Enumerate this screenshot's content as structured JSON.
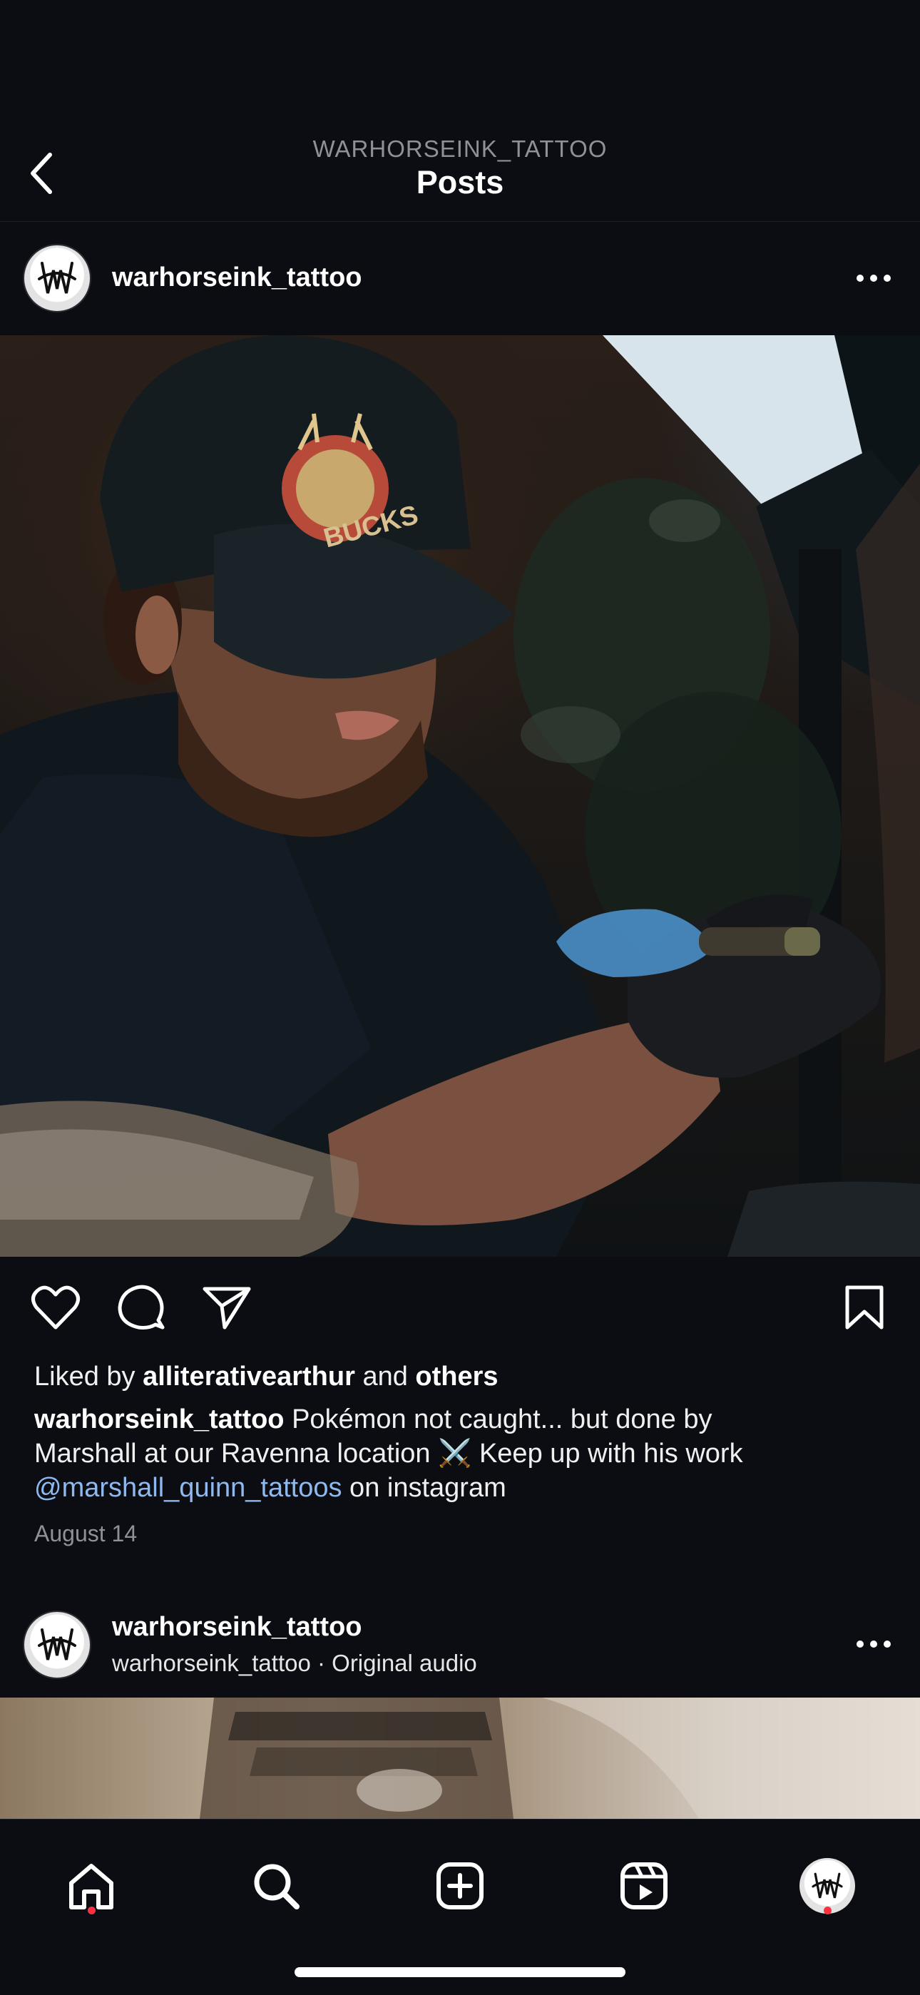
{
  "header": {
    "subtitle": "WARHORSEINK_TATTOO",
    "title": "Posts"
  },
  "post1": {
    "username": "warhorseink_tattoo",
    "liked_by_prefix": "Liked by ",
    "liked_by_user": "alliterativearthur",
    "liked_by_and": " and ",
    "liked_by_others": "others",
    "caption_username": "warhorseink_tattoo",
    "caption_line1": " Pokémon not caught... but done by",
    "caption_line2": "Marshall at our Ravenna location ⚔️ Keep up with his work",
    "caption_mention": "@marshall_quinn_tattoos",
    "caption_line3_rest": " on instagram",
    "date": "August 14",
    "photo_text": "BUCKS"
  },
  "post2": {
    "username": "warhorseink_tattoo",
    "audio": "warhorseink_tattoo · Original audio"
  },
  "icons": {
    "back": "chevron-left-icon",
    "more": "more-horizontal-icon",
    "like": "heart-icon",
    "comment": "comment-icon",
    "share": "send-icon",
    "save": "bookmark-icon",
    "home": "home-icon",
    "search": "search-icon",
    "create": "plus-square-icon",
    "reels": "reels-icon",
    "profile": "avatar"
  },
  "colors": {
    "background": "#0b0d12",
    "mention": "#8fb8ee",
    "notification_dot": "#ff3040",
    "secondary_text": "#8e9198"
  }
}
